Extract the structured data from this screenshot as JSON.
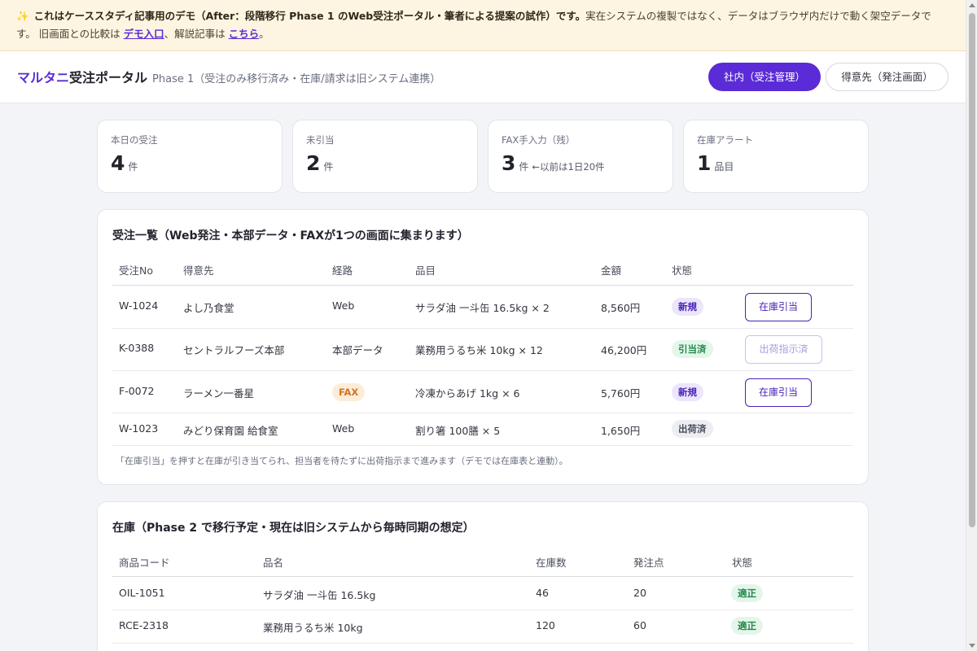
{
  "banner": {
    "lead": "これはケーススタディ記事用のデモ（After：段階移行 Phase 1 のWeb受注ポータル・筆者による提案の試作）です。",
    "body": "実在システムの複製ではなく、データはブラウザ内だけで動く架空データです。",
    "compare_prefix": "旧画面との比較は",
    "compare_link": "デモ入口",
    "article_prefix": "、解説記事は",
    "article_link": "こちら",
    "suffix": "。"
  },
  "header": {
    "brand_accent": "マルタニ",
    "brand_rest": "受注ポータル",
    "phase": "Phase 1（受注のみ移行済み・在庫/請求は旧システム連携）",
    "btn_internal": "社内（受注管理）",
    "btn_customer": "得意先（発注画面）"
  },
  "stats": [
    {
      "label": "本日の受注",
      "value": "4",
      "unit": "件",
      "note": ""
    },
    {
      "label": "未引当",
      "value": "2",
      "unit": "件",
      "note": ""
    },
    {
      "label": "FAX手入力（残）",
      "value": "3",
      "unit": "件",
      "note": "←以前は1日20件"
    },
    {
      "label": "在庫アラート",
      "value": "1",
      "unit": "品目",
      "note": ""
    }
  ],
  "orders": {
    "title": "受注一覧（Web発注・本部データ・FAXが1つの画面に集まります）",
    "headers": [
      "受注No",
      "得意先",
      "経路",
      "品目",
      "金額",
      "状態"
    ],
    "rows": [
      {
        "no": "W-1024",
        "customer": "よし乃食堂",
        "channel": "Web",
        "item": "サラダ油 一斗缶 16.5kg × 2",
        "amount": "8,560円",
        "status": "新規",
        "action": "在庫引当"
      },
      {
        "no": "K-0388",
        "customer": "セントラルフーズ本部",
        "channel": "本部データ",
        "item": "業務用うるち米 10kg × 12",
        "amount": "46,200円",
        "status": "引当済",
        "action": "出荷指示済"
      },
      {
        "no": "F-0072",
        "customer": "ラーメン一番星",
        "channel": "FAX",
        "item": "冷凍からあげ 1kg × 6",
        "amount": "5,760円",
        "status": "新規",
        "action": "在庫引当"
      },
      {
        "no": "W-1023",
        "customer": "みどり保育園 給食室",
        "channel": "Web",
        "item": "割り箸 100膳 × 5",
        "amount": "1,650円",
        "status": "出荷済",
        "action": ""
      }
    ],
    "footnote": "「在庫引当」を押すと在庫が引き当てられ、担当者を待たずに出荷指示まで進みます（デモでは在庫表と連動）。"
  },
  "inventory": {
    "title": "在庫（Phase 2 で移行予定・現在は旧システムから毎時同期の想定）",
    "headers": [
      "商品コード",
      "品名",
      "在庫数",
      "発注点",
      "状態"
    ],
    "rows": [
      {
        "code": "OIL-1051",
        "name": "サラダ油 一斗缶 16.5kg",
        "stock": "46",
        "reorder": "20",
        "status": "適正"
      },
      {
        "code": "RCE-2318",
        "name": "業務用うるち米 10kg",
        "stock": "120",
        "reorder": "60",
        "status": "適正"
      }
    ]
  },
  "colors": {
    "accent": "#5a2bd6",
    "banner_bg": "#fdf5e1",
    "status_new": "#ece6fb",
    "status_ok": "#e4f6ea",
    "fax_badge": "#fcecd9"
  }
}
